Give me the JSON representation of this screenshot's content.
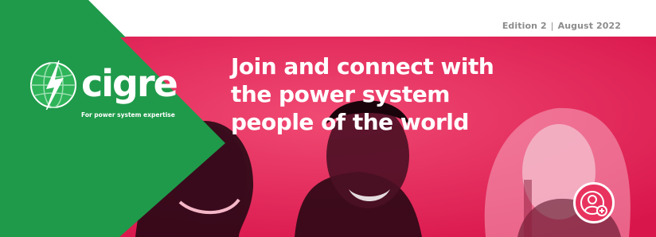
{
  "header": {
    "edition": "Edition 2",
    "date": "August 2022",
    "separator": "|"
  },
  "logo": {
    "wordmark": "cigre",
    "tagline": "For power system expertise"
  },
  "hero": {
    "headline_lines": [
      "Join and connect with",
      "the power system",
      "people of the world"
    ]
  },
  "icons": {
    "logo_mark": "globe-lightning-icon",
    "action": "add-user-icon"
  },
  "colors": {
    "brand_green": "#1f9a4a",
    "accent_pink": "#e01e54",
    "text_gray": "#8c8c8c"
  }
}
